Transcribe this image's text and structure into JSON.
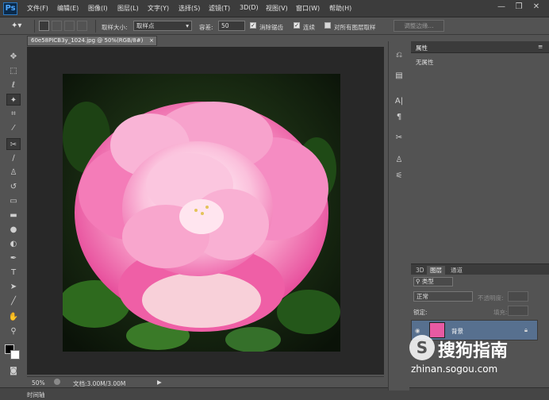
{
  "app": {
    "logo": "Ps"
  },
  "menu": [
    "文件(F)",
    "编辑(E)",
    "图像(I)",
    "图层(L)",
    "文字(Y)",
    "选择(S)",
    "滤镜(T)",
    "3D(D)",
    "视图(V)",
    "窗口(W)",
    "帮助(H)"
  ],
  "window_controls": {
    "minimize": "—",
    "restore": "❐",
    "close": "✕"
  },
  "options_bar": {
    "sample_size_label": "取样大小:",
    "sample_size_value": "取样点",
    "tolerance_label": "容差:",
    "tolerance_value": "50",
    "antialias_label": "消除锯齿",
    "contiguous_label": "连续",
    "sample_all_label": "对所有图层取样",
    "refine_edge_button": "调整边缘..."
  },
  "document": {
    "tab_title": "60e58PICB3y_1024.jpg @ 50%(RGB/8#)",
    "tab_close": "×",
    "zoom": "50%",
    "doc_info": "文档:3.00M/3.00M"
  },
  "timeline_label": "时间轴",
  "properties_panel": {
    "title": "属性",
    "empty_text": "无属性"
  },
  "layers_panel": {
    "tabs": [
      "3D",
      "图层",
      "通道"
    ],
    "filter_kind": "类型",
    "blend_mode": "正常",
    "opacity_label": "不透明度:",
    "lock_label": "锁定:",
    "fill_label": "填充:",
    "layer_name": "背景"
  },
  "watermark": {
    "brand": "搜狗指南",
    "url": "zhinan.sogou.com"
  },
  "colors": {
    "menubar": "#3c3c3c",
    "panel": "#535353",
    "canvas_bg": "#282828",
    "selected_layer": "#57708f",
    "ps_blue": "#2a78c2"
  }
}
